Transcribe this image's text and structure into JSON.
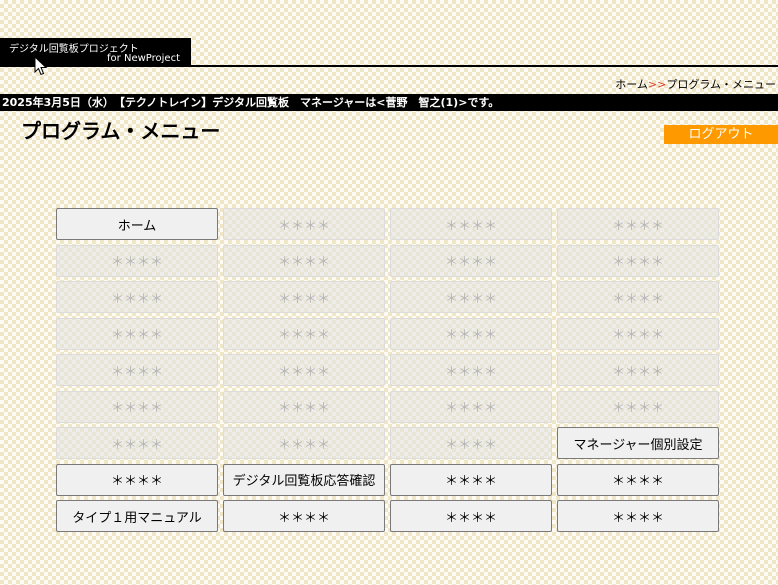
{
  "header": {
    "logo_line1": "デジタル回覧板プロジェクト",
    "logo_line2": "for NewProject"
  },
  "breadcrumb": {
    "home": "ホーム",
    "separator": ">>",
    "current": "プログラム・メニュー"
  },
  "info_bar": "2025年3月5日（水）　【テクノトレイン】デジタル回覧板　マネージャーは<菅野　智之(1)>です。",
  "page_title": "プログラム・メニュー",
  "logout_label": "ログアウト",
  "menu": [
    {
      "label": "ホーム",
      "enabled": true
    },
    {
      "label": "＊＊＊＊",
      "enabled": false
    },
    {
      "label": "＊＊＊＊",
      "enabled": false
    },
    {
      "label": "＊＊＊＊",
      "enabled": false
    },
    {
      "label": "＊＊＊＊",
      "enabled": false
    },
    {
      "label": "＊＊＊＊",
      "enabled": false
    },
    {
      "label": "＊＊＊＊",
      "enabled": false
    },
    {
      "label": "＊＊＊＊",
      "enabled": false
    },
    {
      "label": "＊＊＊＊",
      "enabled": false
    },
    {
      "label": "＊＊＊＊",
      "enabled": false
    },
    {
      "label": "＊＊＊＊",
      "enabled": false
    },
    {
      "label": "＊＊＊＊",
      "enabled": false
    },
    {
      "label": "＊＊＊＊",
      "enabled": false
    },
    {
      "label": "＊＊＊＊",
      "enabled": false
    },
    {
      "label": "＊＊＊＊",
      "enabled": false
    },
    {
      "label": "＊＊＊＊",
      "enabled": false
    },
    {
      "label": "＊＊＊＊",
      "enabled": false
    },
    {
      "label": "＊＊＊＊",
      "enabled": false
    },
    {
      "label": "＊＊＊＊",
      "enabled": false
    },
    {
      "label": "＊＊＊＊",
      "enabled": false
    },
    {
      "label": "＊＊＊＊",
      "enabled": false
    },
    {
      "label": "＊＊＊＊",
      "enabled": false
    },
    {
      "label": "＊＊＊＊",
      "enabled": false
    },
    {
      "label": "＊＊＊＊",
      "enabled": false
    },
    {
      "label": "＊＊＊＊",
      "enabled": false
    },
    {
      "label": "＊＊＊＊",
      "enabled": false
    },
    {
      "label": "＊＊＊＊",
      "enabled": false
    },
    {
      "label": "マネージャー個別設定",
      "enabled": true
    },
    {
      "label": "＊＊＊＊",
      "enabled": true
    },
    {
      "label": "デジタル回覧板応答確認",
      "enabled": true
    },
    {
      "label": "＊＊＊＊",
      "enabled": true
    },
    {
      "label": "＊＊＊＊",
      "enabled": true
    },
    {
      "label": "タイプ１用マニュアル",
      "enabled": true
    },
    {
      "label": "＊＊＊＊",
      "enabled": true
    },
    {
      "label": "＊＊＊＊",
      "enabled": true
    },
    {
      "label": "＊＊＊＊",
      "enabled": true
    }
  ],
  "colors": {
    "logout_bg": "#ff9900",
    "breadcrumb_separator": "#e0402a",
    "header_bg": "#000000"
  },
  "icons": {
    "cursor": "mouse-pointer-icon"
  }
}
